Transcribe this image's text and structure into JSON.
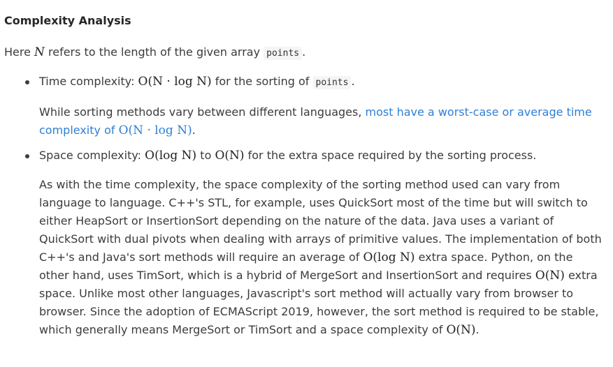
{
  "heading": "Complexity Analysis",
  "intro": {
    "prefix": "Here ",
    "var": "N",
    "middle": " refers to the length of the given array ",
    "code": "points",
    "suffix": "."
  },
  "time": {
    "label": "Time complexity: ",
    "math": "O(N · log N)",
    "middle": " for the sorting of ",
    "code": "points",
    "suffix": ".",
    "detail_prefix": "While sorting methods vary between different languages, ",
    "link_text": "most have a worst-case or average time complexity of ",
    "link_math": "O(N · log N)",
    "detail_suffix": "."
  },
  "space": {
    "label": "Space complexity: ",
    "math_a": "O(log N)",
    "to": " to ",
    "math_b": "O(N)",
    "suffix": " for the extra space required by the sorting process.",
    "p1": "As with the time complexity, the space complexity of the sorting method used can vary from language to language. C++'s STL, for example, uses QuickSort most of the time but will switch to either HeapSort or InsertionSort depending on the nature of the data. Java uses a variant of QuickSort with dual pivots when dealing with arrays of primitive values. The implementation of both C++'s and Java's sort methods will require an average of ",
    "m1": "O(log N)",
    "p2": " extra space. Python, on the other hand, uses TimSort, which is a hybrid of MergeSort and InsertionSort and requires ",
    "m2": "O(N)",
    "p3": " extra space. Unlike most other languages, Javascript's sort method will actually vary from browser to browser. Since the adoption of ECMAScript 2019, however, the sort method is required to be stable, which generally means MergeSort or TimSort and a space complexity of ",
    "m3": "O(N)",
    "p4": "."
  }
}
